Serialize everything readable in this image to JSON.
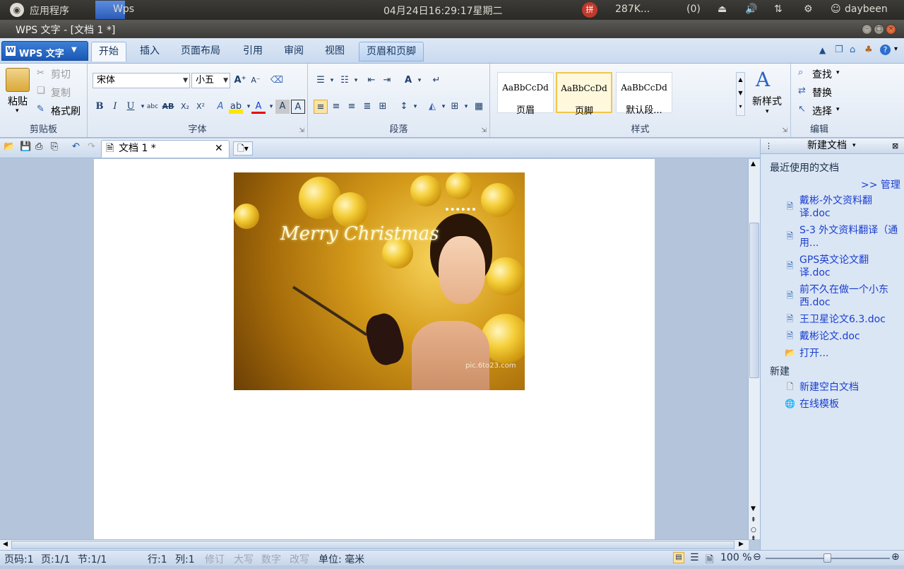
{
  "system_bar": {
    "apps_menu": "应用程序",
    "active_app": "Wps",
    "datetime": "04月24日16:29:17星期二",
    "ime": "拼",
    "network_speed": "287K...",
    "mail_count": "(0)",
    "user": "daybeen"
  },
  "window": {
    "title": "WPS 文字 - [文档 1 *]"
  },
  "ribbon_tabs": {
    "app_menu": "WPS 文字",
    "tabs": [
      "开始",
      "插入",
      "页面布局",
      "引用",
      "审阅",
      "视图",
      "页眉和页脚"
    ]
  },
  "ribbon": {
    "clipboard": {
      "paste": "粘贴",
      "cut": "剪切",
      "copy": "复制",
      "format_painter": "格式刷",
      "label": "剪贴板"
    },
    "font": {
      "font_name": "宋体",
      "font_size": "小五",
      "label": "字体"
    },
    "paragraph": {
      "label": "段落"
    },
    "styles": {
      "sample_text": "AaBbCcDd",
      "items": [
        "页眉",
        "页脚",
        "默认段..."
      ],
      "new_style": "新样式",
      "label": "样式"
    },
    "editing": {
      "find": "查找",
      "replace": "替换",
      "select": "选择",
      "label": "编辑"
    }
  },
  "doc_tabs": {
    "current": "文档 1 *"
  },
  "document": {
    "image_greeting": "Merry Christmas",
    "image_watermark": "pic.6to23.com"
  },
  "task_pane": {
    "title": "新建文档",
    "recent_header": "最近使用的文档",
    "manage": ">> 管理",
    "recent_files": [
      "戴彬-外文资料翻译.doc",
      "S-3 外文资料翻译（通用...",
      "GPS英文论文翻译.doc",
      "前不久在做一个小东西.doc",
      "王卫星论文6.3.doc",
      "戴彬论文.doc"
    ],
    "open": "打开...",
    "new_header": "新建",
    "new_blank": "新建空白文档",
    "online_templates": "在线模板"
  },
  "status_bar": {
    "page_code": "页码:1",
    "page": "页:1/1",
    "section": "节:1/1",
    "row": "行:1",
    "col": "列:1",
    "revise": "修订",
    "caps": "大写",
    "num": "数字",
    "overwrite": "改写",
    "unit": "单位: 毫米",
    "zoom": "100 %"
  },
  "colors": {
    "accent": "#1a58b5",
    "link": "#1a3fcf",
    "ribbon_bg": "#dfe8f4"
  }
}
